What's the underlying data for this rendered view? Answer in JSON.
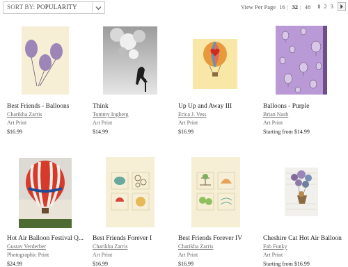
{
  "toolbar": {
    "sort_prefix": "SORT BY:",
    "sort_value": "POPULARITY",
    "view_per_page_label": "View Per Page",
    "per_page_options": [
      "16",
      "32",
      "48"
    ],
    "per_page_selected": "32",
    "pages": [
      "1",
      "2",
      "3"
    ],
    "current_page": "1"
  },
  "products": [
    {
      "title": "Best Friends - Balloons",
      "artist": "Charikha Zarris",
      "type": "Art Print",
      "price": "$16.99"
    },
    {
      "title": "Think",
      "artist": "Tommy Ingberg",
      "type": "Art Print",
      "price": "$14.99"
    },
    {
      "title": "Up Up and Away III",
      "artist": "Erica J. Vess",
      "type": "Art Print",
      "price": "$16.99"
    },
    {
      "title": "Balloons - Purple",
      "artist": "Brian Nash",
      "type": "Art Print",
      "price": "Starting from $14.99"
    },
    {
      "title": "Hot Air Balloon Festival Q...",
      "artist": "Gustav Verderber",
      "type": "Photographic Print",
      "price": "$24.99"
    },
    {
      "title": "Best Friends Forever I",
      "artist": "Charikha Zarris",
      "type": "Art Print",
      "price": "$16.99"
    },
    {
      "title": "Best Friends Forever IV",
      "artist": "Charikha Zarris",
      "type": "Art Print",
      "price": "$16.99"
    },
    {
      "title": "Cheshire Cat Hot Air Balloon",
      "artist": "Fab Funky",
      "type": "Art Print",
      "price": "Starting from $16.99"
    }
  ]
}
